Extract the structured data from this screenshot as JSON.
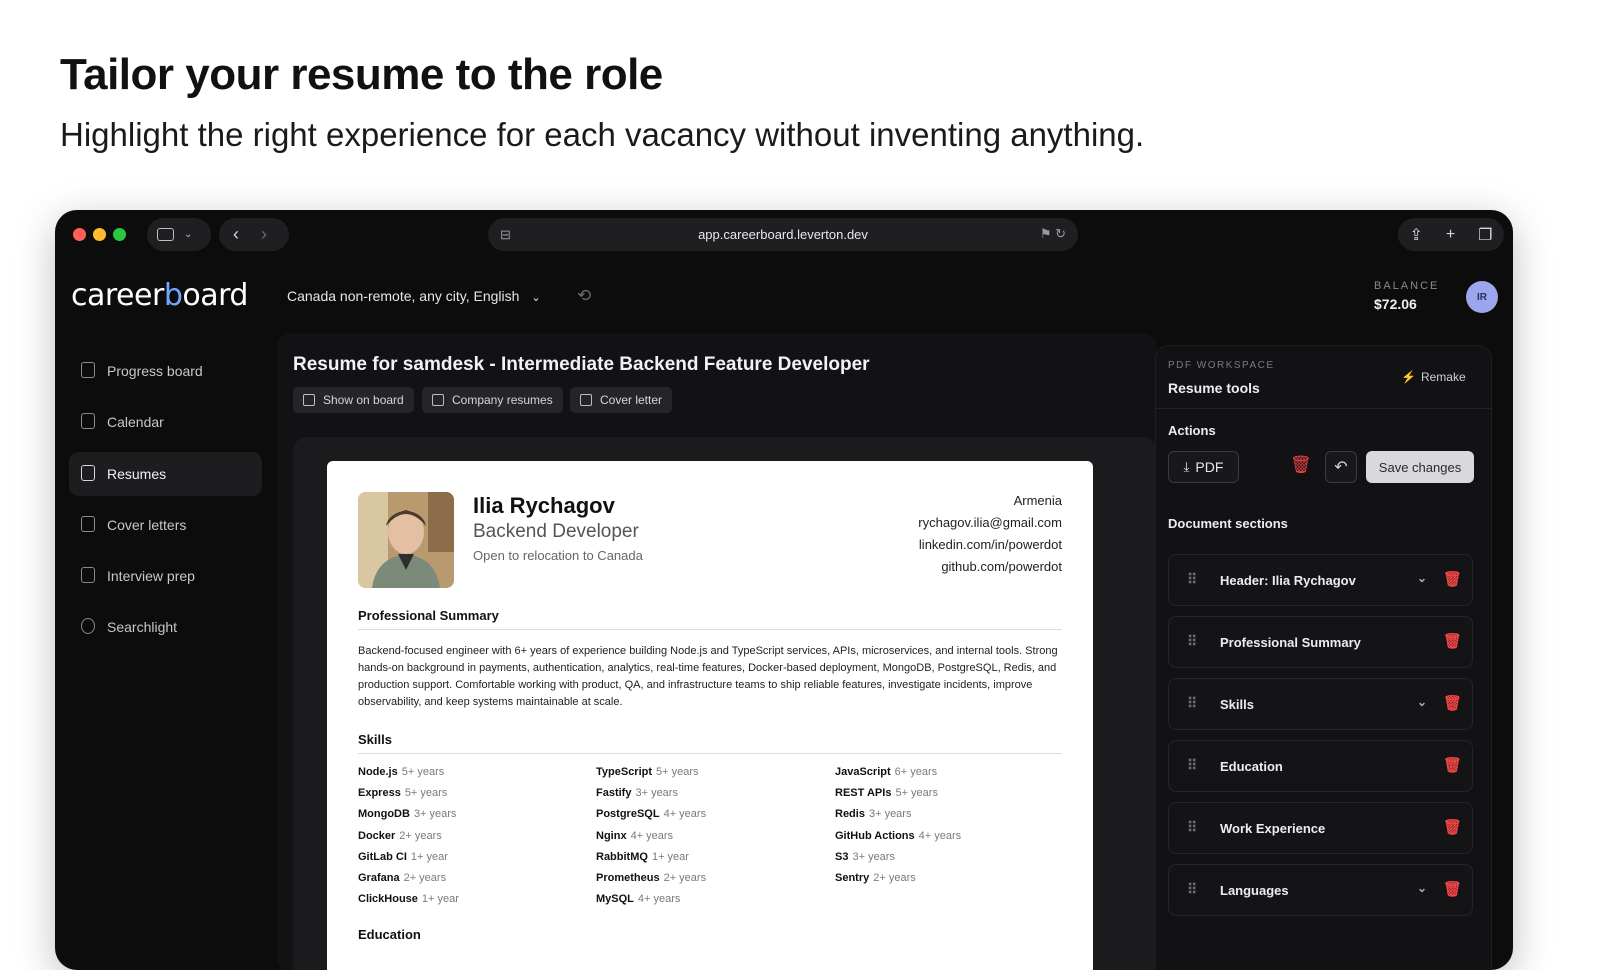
{
  "hero": {
    "title": "Tailor your resume to the role",
    "subtitle": "Highlight the right experience for each vacancy without inventing anything."
  },
  "browser": {
    "url": "app.careerboard.leverton.dev"
  },
  "app": {
    "logo": "careerboard",
    "location_filter": "Canada non-remote, any city, English",
    "balance_label": "BALANCE",
    "balance_value": "$72.06",
    "user_initials": "IR"
  },
  "sidebar": {
    "items": [
      {
        "label": "Progress board"
      },
      {
        "label": "Calendar"
      },
      {
        "label": "Resumes"
      },
      {
        "label": "Cover letters"
      },
      {
        "label": "Interview prep"
      },
      {
        "label": "Searchlight"
      }
    ]
  },
  "doc": {
    "title": "Resume for samdesk - Intermediate Backend Feature Developer",
    "buttons": [
      "Show on board",
      "Company resumes",
      "Cover letter"
    ]
  },
  "resume": {
    "name": "Ilia Rychagov",
    "role": "Backend Developer",
    "relocation": "Open to relocation to Canada",
    "contact": [
      "Armenia",
      "rychagov.ilia@gmail.com",
      "linkedin.com/in/powerdot",
      "github.com/powerdot"
    ],
    "summary_heading": "Professional Summary",
    "summary": "Backend-focused engineer with 6+ years of experience building Node.js and TypeScript services, APIs, microservices, and internal tools. Strong hands-on background in payments, authentication, analytics, real-time features, Docker-based deployment, MongoDB, PostgreSQL, Redis, and production support. Comfortable working with product, QA, and infrastructure teams to ship reliable features, investigate incidents, improve observability, and keep systems maintainable at scale.",
    "skills_heading": "Skills",
    "skills": [
      [
        {
          "name": "Node.js",
          "years": "5+ years"
        },
        {
          "name": "Express",
          "years": "5+ years"
        },
        {
          "name": "MongoDB",
          "years": "3+ years"
        },
        {
          "name": "Docker",
          "years": "2+ years"
        },
        {
          "name": "GitLab CI",
          "years": "1+ year"
        },
        {
          "name": "Grafana",
          "years": "2+ years"
        },
        {
          "name": "ClickHouse",
          "years": "1+ year"
        }
      ],
      [
        {
          "name": "TypeScript",
          "years": "5+ years"
        },
        {
          "name": "Fastify",
          "years": "3+ years"
        },
        {
          "name": "PostgreSQL",
          "years": "4+ years"
        },
        {
          "name": "Nginx",
          "years": "4+ years"
        },
        {
          "name": "RabbitMQ",
          "years": "1+ year"
        },
        {
          "name": "Prometheus",
          "years": "2+ years"
        },
        {
          "name": "MySQL",
          "years": "4+ years"
        }
      ],
      [
        {
          "name": "JavaScript",
          "years": "6+ years"
        },
        {
          "name": "REST APIs",
          "years": "5+ years"
        },
        {
          "name": "Redis",
          "years": "3+ years"
        },
        {
          "name": "GitHub Actions",
          "years": "4+ years"
        },
        {
          "name": "S3",
          "years": "3+ years"
        },
        {
          "name": "Sentry",
          "years": "2+ years"
        }
      ]
    ],
    "education_heading": "Education"
  },
  "panel": {
    "label": "PDF WORKSPACE",
    "title": "Resume tools",
    "remake": "Remake",
    "actions_heading": "Actions",
    "pdf_label": "PDF",
    "save_label": "Save changes",
    "sections_heading": "Document sections",
    "sections": [
      {
        "label": "Header: Ilia Rychagov",
        "expandable": true
      },
      {
        "label": "Professional Summary",
        "expandable": false
      },
      {
        "label": "Skills",
        "expandable": true
      },
      {
        "label": "Education",
        "expandable": false
      },
      {
        "label": "Work Experience",
        "expandable": false
      },
      {
        "label": "Languages",
        "expandable": true
      }
    ]
  },
  "colors": {
    "accent_blue": "#6ea8ff",
    "danger": "#ef4444",
    "traffic_red": "#ff5f57",
    "traffic_yellow": "#febc2e",
    "traffic_green": "#28c840"
  }
}
